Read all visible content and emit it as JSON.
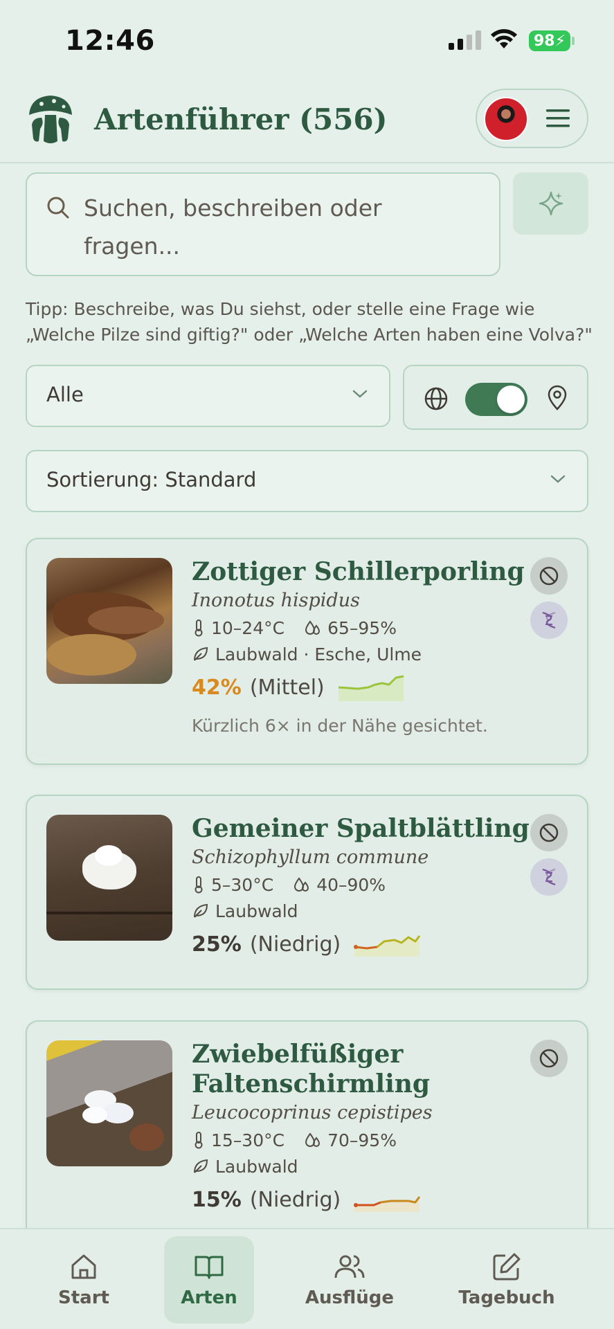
{
  "status_bar": {
    "time": "12:46",
    "battery": "98"
  },
  "header": {
    "title": "Artenführer (556)"
  },
  "search": {
    "placeholder": "Suchen, beschreiben oder fragen..."
  },
  "tip": "Tipp: Beschreibe, was Du siehst, oder stelle eine Frage wie „Welche Pilze sind giftig?\" oder „Welche Arten haben eine Volva?\"",
  "filter": {
    "category_selected": "Alle",
    "location_toggle_on": true
  },
  "sort": {
    "label": "Sortierung: Standard"
  },
  "cards": [
    {
      "name": "Zottiger Schillerporling",
      "latin": "Inonotus hispidus",
      "temp": "10–24°C",
      "humidity": "65–95%",
      "habitat": "Laubwald · Esche, Ulme",
      "probability": "42%",
      "probability_label": "(Mittel)",
      "probability_color": "#d98a1f",
      "note": "Kürzlich 6× in der Nähe gesichtet."
    },
    {
      "name": "Gemeiner Spaltblättling",
      "latin": "Schizophyllum commune",
      "temp": "5–30°C",
      "humidity": "40–90%",
      "habitat": "Laubwald",
      "probability": "25%",
      "probability_label": "(Niedrig)",
      "probability_color": "#4e4942"
    },
    {
      "name_line1": "Zwiebelfüßiger",
      "name_line2": "Faltenschirmling",
      "latin": "Leucocoprinus cepistipes",
      "temp": "15–30°C",
      "humidity": "70–95%",
      "habitat": "Laubwald",
      "probability": "15%",
      "probability_label": "(Niedrig)",
      "probability_color": "#4e4942"
    }
  ],
  "nav": [
    {
      "label": "Start",
      "icon": "home-icon"
    },
    {
      "label": "Arten",
      "icon": "book-icon",
      "active": true
    },
    {
      "label": "Ausflüge",
      "icon": "users-icon"
    },
    {
      "label": "Tagebuch",
      "icon": "edit-icon"
    }
  ],
  "colors": {
    "primary": "#3f7a55",
    "heading": "#2f5a42",
    "background": "#e6f0ea"
  }
}
